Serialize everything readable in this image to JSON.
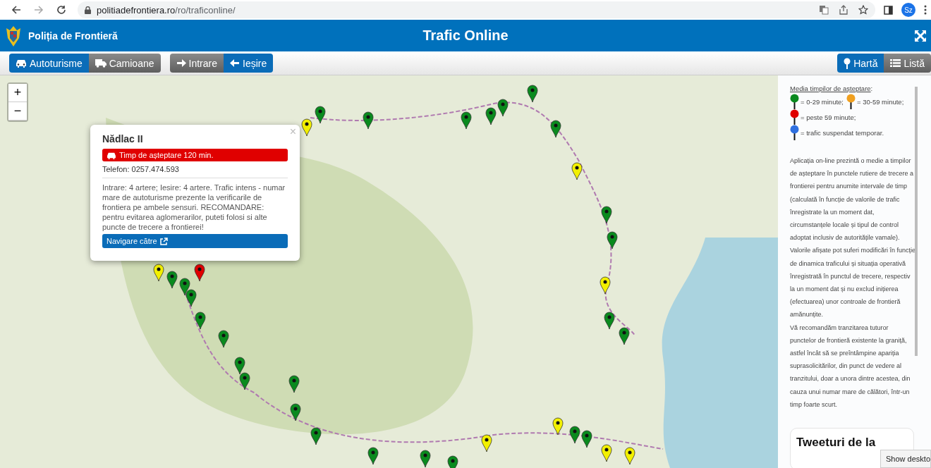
{
  "browser": {
    "url_domain": "politiadefrontiera.ro",
    "url_path": "/ro/traficonline/",
    "profile": "Sz"
  },
  "header": {
    "brand": "Poliția de Frontieră",
    "title": "Trafic Online"
  },
  "toolbar": {
    "groups": [
      [
        {
          "label": "Autoturisme",
          "kind": "car",
          "selected": true
        },
        {
          "label": "Camioane",
          "kind": "truck",
          "selected": false
        }
      ],
      [
        {
          "label": "Intrare",
          "kind": "right",
          "selected": false
        },
        {
          "label": "Ieșire",
          "kind": "left",
          "selected": true
        }
      ]
    ],
    "view_tabs": [
      {
        "label": "Hartă",
        "kind": "pin",
        "selected": true
      },
      {
        "label": "Listă",
        "kind": "list",
        "selected": false
      }
    ]
  },
  "map": {
    "zoom_in": "+",
    "zoom_out": "−",
    "pins": [
      {
        "color": "#0a8a1e"
      },
      {
        "color": "#0a8a1e"
      },
      {
        "color": "#0a8a1e"
      },
      {
        "color": "#0a8a1e"
      },
      {
        "color": "#0a8a1e"
      },
      {
        "color": "#0a8a1e"
      },
      {
        "color": "#0a8a1e"
      },
      {
        "color": "#0a8a1e"
      },
      {
        "color": "#0a8a1e"
      },
      {
        "color": "#0a8a1e"
      },
      {
        "color": "#0a8a1e"
      },
      {
        "color": "#0a8a1e"
      },
      {
        "color": "#0a8a1e"
      },
      {
        "color": "#0a8a1e"
      },
      {
        "color": "#0a8a1e"
      },
      {
        "color": "#0a8a1e"
      },
      {
        "color": "#0a8a1e"
      },
      {
        "color": "#0a8a1e"
      },
      {
        "color": "#0a8a1e"
      },
      {
        "color": "#0a8a1e"
      },
      {
        "color": "#0a8a1e"
      },
      {
        "color": "#0a8a1e"
      },
      {
        "color": "#0a8a1e"
      },
      {
        "color": "#0a8a1e"
      },
      {
        "color": "#0a8a1e"
      },
      {
        "color": "#0a8a1e"
      },
      {
        "color": "#f2f000"
      },
      {
        "color": "#f2f000"
      },
      {
        "color": "#f2f000"
      },
      {
        "color": "#f2f000"
      },
      {
        "color": "#f2f000"
      },
      {
        "color": "#f2f000"
      },
      {
        "color": "#f2f000"
      },
      {
        "color": "#f2f000"
      },
      {
        "color": "#e00000"
      }
    ],
    "popup": {
      "close": "×",
      "title": "Nădlac II",
      "alert": {
        "text": "Timp de așteptare 120 min.",
        "color": "#e00000"
      },
      "phone": "Telefon: 0257.474.593",
      "description": "Intrare: 4 artere; Iesire: 4 artere. Trafic intens - numar mare de autoturisme prezente la verificarile de frontiera pe ambele sensuri. RECOMANDARE: pentru evitarea aglomerarilor, puteti folosi si alte puncte de trecere a frontierei!",
      "button": "Navigare către"
    }
  },
  "sidebar": {
    "legend": {
      "title": "Media timpilor de așteptare",
      "title_suffix": ":",
      "rows": [
        [
          {
            "color": "#0a8a1e",
            "text": "= 0-29 minute;"
          },
          {
            "color": "#f0a020",
            "text": "= 30-59 minute;"
          }
        ],
        [
          {
            "color": "#e00000",
            "text": "= peste 59 minute;"
          }
        ],
        [
          {
            "color": "#3070e0",
            "text": "= trafic suspendat temporar."
          }
        ]
      ]
    },
    "paragraphs": [
      "Aplicația on-line prezintă o medie a timpilor de așteptare în punctele rutiere de trecere a frontierei pentru anumite intervale de timp (calculată în funcție de valorile de trafic înregistrate la un moment dat, circumstanțele locale și tipul de control adoptat inclusiv de autoritățile vamale).",
      "Valorile afișate pot suferi modificări în funcție de dinamica traficului și situația operativă înregistrată în punctul de trecere, respectiv la un moment dat și nu exclud inițierea (efectuarea) unor controale de frontieră amănunțite.",
      "Vă recomandăm tranzitarea tuturor punctelor de frontieră existente la graniță, astfel încât să se preîntâmpine apariția suprasolicitărilor, din punct de vedere al tranzitului, doar a unora dintre acestea, din cauza unui numar mare de călători, într-un timp foarte scurt."
    ],
    "tweets_title": "Tweeturi de la"
  },
  "tooltip": "Show deskto"
}
